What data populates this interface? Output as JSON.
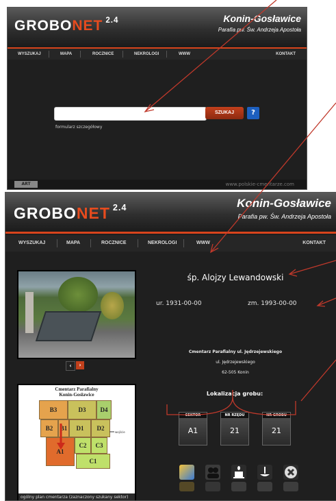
{
  "top_window": {
    "logo": {
      "part1": "GROBO",
      "part2": "NET",
      "version": "2.4"
    },
    "place_title": "Konin-Gosławice",
    "place_subtitle": "Parafia pw. Św. Andrzeja Apostoła",
    "nav": [
      "WYSZUKAJ",
      "MAPA",
      "ROCZNICE",
      "NEKROLOGI",
      "WWW",
      "KONTAKT"
    ],
    "search": {
      "value": "",
      "button_label": "SZUKAJ",
      "help_label": "?",
      "advanced_link": "formularz szczegółowy"
    },
    "footer_logo": "ART",
    "footer_url": "www.polskie-cmentarze.com"
  },
  "bottom_window": {
    "logo": {
      "part1": "GROBO",
      "part2": "NET",
      "version": "2.4"
    },
    "place_title": "Konin-Gosławice",
    "place_subtitle": "Parafia pw. Św. Andrzeja Apostoła",
    "nav": [
      "WYSZUKAJ",
      "MAPA",
      "ROCZNICE",
      "NEKROLOGI",
      "WWW",
      "KONTAKT"
    ],
    "person_name": "śp. Alojzy Lewandowski",
    "born": "ur. 1931-00-00",
    "died": "zm. 1993-00-00",
    "cemetery": {
      "name": "Cmentarz Parafialny ul. Jędrzejewskiego",
      "street": "ul. Jędrzejewskiego",
      "city": "62-505   Konin"
    },
    "location_title": "Lokalizacja grobu:",
    "location": [
      {
        "label": "SEKTOR",
        "value": "A1"
      },
      {
        "label": "NR RZĘDU",
        "value": "21"
      },
      {
        "label": "NR GROBU",
        "value": "21"
      }
    ],
    "photo_nav": {
      "prev": "‹",
      "next": "›"
    },
    "map": {
      "title_line1": "Cmentarz Parafialny",
      "title_line2": "Konin-Gosławice",
      "sectors": [
        "B3",
        "D3",
        "D4",
        "B2",
        "B1",
        "D1",
        "D2",
        "A1",
        "C2",
        "C3",
        "C1"
      ],
      "side_label": "wejście",
      "caption": "ogólny plan cmentarza (zaznaczony szukany sektor)"
    },
    "action_icons": [
      "photo-icon",
      "people-icon",
      "candle-icon",
      "lamp-icon",
      "close-icon"
    ]
  },
  "colors": {
    "accent": "#d8441c",
    "background": "#1f1f1f",
    "annotation": "#c0392b",
    "help": "#1d5fbf"
  }
}
